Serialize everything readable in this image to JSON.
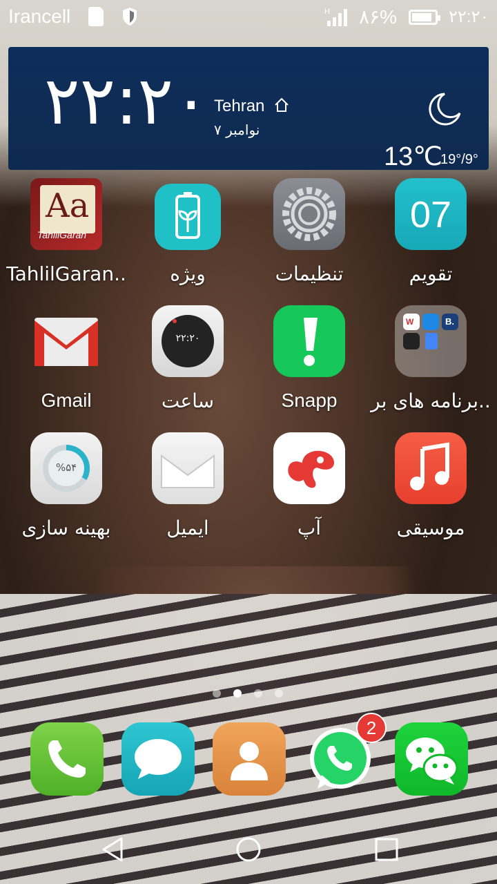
{
  "status_bar": {
    "carrier": "Irancell",
    "battery_percent": "۸۶%",
    "battery_level": 0.86,
    "time": "۲۲:۲۰"
  },
  "widget": {
    "clock": "۲۲:۲۰",
    "city": "Tehran",
    "date": "۷ نوامبر",
    "temperature": "13℃",
    "range": "19°/9°"
  },
  "apps": [
    {
      "label": "TahlilGaran..",
      "icon": "dictionary-aa-icon"
    },
    {
      "label": "ویژه",
      "icon": "battery-leaf-icon"
    },
    {
      "label": "تنظیمات",
      "icon": "gear-icon"
    },
    {
      "label": "تقویم",
      "icon": "calendar-icon",
      "icon_text": "07"
    },
    {
      "label": "Gmail",
      "icon": "gmail-icon"
    },
    {
      "label": "ساعت",
      "icon": "clock-icon",
      "icon_text": "۲۲:۲۰"
    },
    {
      "label": "Snapp",
      "icon": "snapp-icon"
    },
    {
      "label": "برنامه های بر..",
      "icon": "folder-icon"
    },
    {
      "label": "بهینه سازی",
      "icon": "optimizer-icon",
      "icon_text": "%۵۴"
    },
    {
      "label": "ایمیل",
      "icon": "email-icon"
    },
    {
      "label": "آپ",
      "icon": "ap-icon"
    },
    {
      "label": "موسیقی",
      "icon": "music-icon"
    }
  ],
  "dock": [
    {
      "name": "phone",
      "icon": "phone-icon"
    },
    {
      "name": "messages",
      "icon": "messages-icon"
    },
    {
      "name": "contacts",
      "icon": "contacts-icon"
    },
    {
      "name": "whatsapp",
      "icon": "whatsapp-icon",
      "badge": "2"
    },
    {
      "name": "wechat",
      "icon": "wechat-icon"
    }
  ],
  "page_indicator": {
    "count": 4,
    "active": 2
  },
  "colors": {
    "widget_bg": "#0d2e5a",
    "calendar": "#1fb5c4",
    "snapp": "#16c759",
    "music": "#f0503a",
    "badge": "#e53935"
  }
}
